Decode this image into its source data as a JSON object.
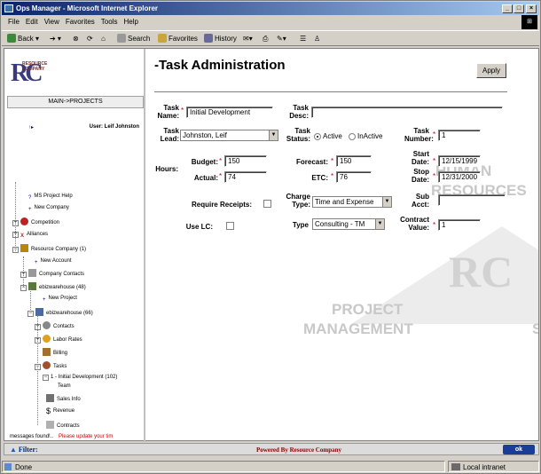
{
  "window": {
    "title": "Ops Manager - Microsoft Internet Explorer",
    "min": "_",
    "max": "□",
    "close": "×"
  },
  "menu": [
    "File",
    "Edit",
    "View",
    "Favorites",
    "Tools",
    "Help"
  ],
  "toolbar": {
    "back": "Back",
    "search": "Search",
    "favorites": "Favorites",
    "history": "History"
  },
  "sidebar": {
    "logo_sub_1": "RESOURCE",
    "logo_sub_2": "COMPANY",
    "logo_rc": "RC",
    "nav_path": "MAIN->PROJECTS",
    "user": "User: Leif Johnston",
    "items": [
      {
        "label": "MS Project Help"
      },
      {
        "label": "New Company"
      },
      {
        "label": "Competition"
      },
      {
        "label": "Alliances"
      },
      {
        "label": "Resource Company (1)"
      },
      {
        "label": "New Account"
      },
      {
        "label": "Company Contacts"
      },
      {
        "label": "ebizwarehouse (48)"
      },
      {
        "label": "New Project"
      },
      {
        "label": "ebizwarehouse (66)"
      },
      {
        "label": "Contacts"
      },
      {
        "label": "Labor Rates"
      },
      {
        "label": "Billing"
      },
      {
        "label": "Tasks"
      },
      {
        "label": "1 - Initial Development (102)"
      },
      {
        "label": "Team"
      },
      {
        "label": "Sales Info"
      },
      {
        "label": "Revenue"
      },
      {
        "label": "Contracts"
      }
    ],
    "footer_msg": "messages found!..",
    "footer_err": "Please update your tim"
  },
  "watermark": {
    "human": "HUMAN",
    "resources": "RESOURCES",
    "project": "PROJECT",
    "management": "MANAGEMENT",
    "rc": "RC",
    "s": "S"
  },
  "form": {
    "page_title": "-Task Administration",
    "apply": "Apply",
    "task_name_label_1": "Task",
    "task_name_label_2": "Name:",
    "task_name": "Initial Development",
    "task_desc_label_1": "Task",
    "task_desc_label_2": "Desc:",
    "task_desc": "",
    "task_lead_label_1": "Task",
    "task_lead_label_2": "Lead:",
    "task_lead": "Johnston, Leif",
    "task_status_label_1": "Task",
    "task_status_label_2": "Status:",
    "status_active": "Active",
    "status_inactive": "InActive",
    "task_number_label_1": "Task",
    "task_number_label_2": "Number:",
    "task_number": "1",
    "hours_label": "Hours:",
    "budget_label": "Budget:",
    "budget": "150",
    "actual_label": "Actual:",
    "actual": "74",
    "forecast_label": "Forecast:",
    "forecast": "150",
    "etc_label": "ETC:",
    "etc": "76",
    "start_label_1": "Start",
    "start_label_2": "Date:",
    "start_date": "12/15/1999",
    "stop_label_1": "Stop",
    "stop_label_2": "Date:",
    "stop_date": "12/31/2000",
    "receipts_label": "Require Receipts:",
    "charge_label_1": "Charge",
    "charge_label_2": "Type:",
    "charge_type": "Time and Expense",
    "sub_label_1": "Sub",
    "sub_label_2": "Acct:",
    "sub_acct": "",
    "uselc_label": "Use LC:",
    "type_label": "Type",
    "type_value": "Consulting - TM",
    "contract_label_1": "Contract",
    "contract_label_2": "Value:",
    "contract_value": "1",
    "req_mark": "*"
  },
  "bottom": {
    "filter": "Filter:",
    "powered": "Powered By Resource Company",
    "ok": "ok"
  },
  "status": {
    "done": "Done",
    "zone": "Local intranet"
  }
}
